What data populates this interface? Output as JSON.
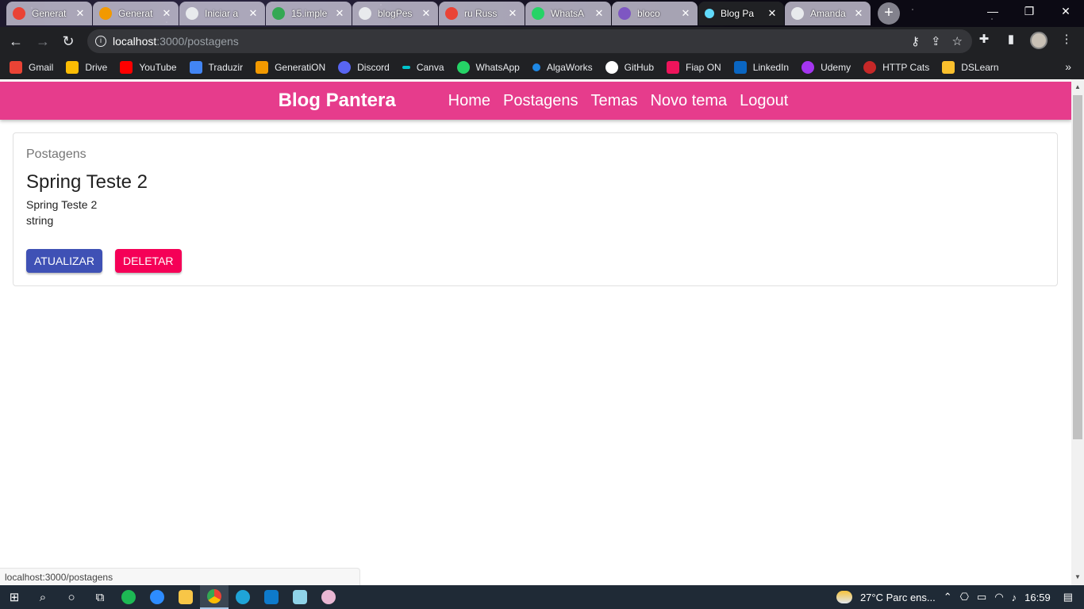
{
  "browser": {
    "tabs": [
      {
        "title": "Generat",
        "fav_color": "#ea4335"
      },
      {
        "title": "Generat",
        "fav_color": "#f29900"
      },
      {
        "title": "Iniciar a",
        "fav_color": "#e8eaed"
      },
      {
        "title": "15.imple",
        "fav_color": "#34a853"
      },
      {
        "title": "blogPes",
        "fav_color": "#e8eaed"
      },
      {
        "title": "ru Russ",
        "fav_color": "#ea4335"
      },
      {
        "title": "WhatsA",
        "fav_color": "#25d366"
      },
      {
        "title": "bloco",
        "fav_color": "#7e57c2"
      },
      {
        "title": "Blog Pa",
        "fav_color": "#61dafb"
      },
      {
        "title": "Amanda",
        "fav_color": "#e8eaed"
      }
    ],
    "new_tab": "+",
    "window_controls": {
      "minimize": "—",
      "restore": "❐",
      "close": "✕"
    },
    "address": {
      "host": "localhost",
      "path": ":3000/postagens"
    },
    "bookmarks": [
      {
        "label": "Gmail",
        "color": "#ea4335"
      },
      {
        "label": "Drive",
        "color": "#fbbc04"
      },
      {
        "label": "YouTube",
        "color": "#ff0000"
      },
      {
        "label": "Traduzir",
        "color": "#4285f4"
      },
      {
        "label": "GeneratiON",
        "color": "#f29900"
      },
      {
        "label": "Discord",
        "color": "#5865f2"
      },
      {
        "label": "Canva",
        "color": "#00c4cc"
      },
      {
        "label": "WhatsApp",
        "color": "#25d366"
      },
      {
        "label": "AlgaWorks",
        "color": "#1e88e5"
      },
      {
        "label": "GitHub",
        "color": "#ffffff"
      },
      {
        "label": "Fiap ON",
        "color": "#ed145b"
      },
      {
        "label": "LinkedIn",
        "color": "#0a66c2"
      },
      {
        "label": "Udemy",
        "color": "#a435f0"
      },
      {
        "label": "HTTP Cats",
        "color": "#c62828"
      },
      {
        "label": "DSLearn",
        "color": "#fbc02d"
      }
    ],
    "status_url": "localhost:3000/postagens"
  },
  "app": {
    "brand": "Blog Pantera",
    "nav": [
      "Home",
      "Postagens",
      "Temas",
      "Novo tema",
      "Logout"
    ],
    "accent": "#e63c8c"
  },
  "post": {
    "kicker": "Postagens",
    "title": "Spring Teste 2",
    "body_lines": [
      "Spring Teste 2",
      "string"
    ],
    "update_label": "atualizar",
    "delete_label": "deletar"
  },
  "taskbar": {
    "weather": "27°C  Parc ens...",
    "time": "16:59"
  }
}
